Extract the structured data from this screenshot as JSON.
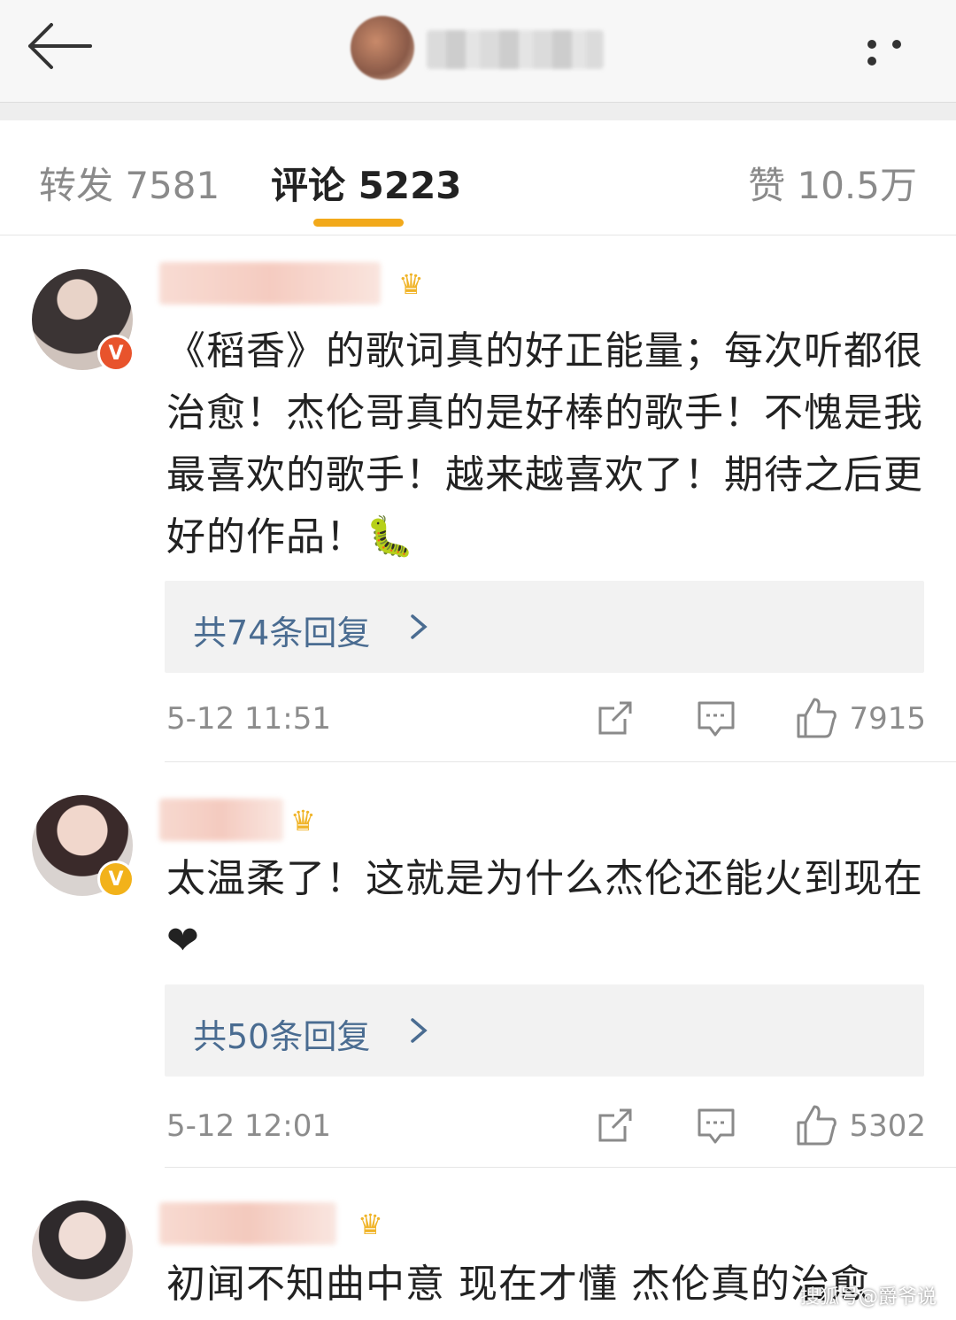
{
  "header": {
    "back_icon": "arrow-left-icon",
    "more_icon": "more-dots-icon"
  },
  "tabs": [
    {
      "label": "转发 7581"
    },
    {
      "label": "评论 5223"
    },
    {
      "label": "赞 10.5万"
    }
  ],
  "colors": {
    "accent": "#f2a91a",
    "link": "#4a6c91",
    "meta": "#8c8c8c",
    "verified_red": "#e8532c",
    "verified_gold": "#f2b21a"
  },
  "comments": [
    {
      "name_suffix": "大姐姐",
      "badge_icon": "verified-red-v-icon",
      "text": "《稻香》的歌词真的好正能量；每次听都很治愈！杰伦哥真的是好棒的歌手！不愧是我最喜欢的歌手！越来越喜欢了！期待之后更好的作品！🐛",
      "replies": "共74条回复",
      "time": "5-12 11:51",
      "likes": "7915"
    },
    {
      "name_suffix": "",
      "badge_icon": "verified-gold-v-icon",
      "text": "太温柔了！这就是为什么杰伦还能火到现在❤",
      "replies": "共50条回复",
      "time": "5-12 12:01",
      "likes": "5302"
    },
    {
      "name_suffix": "VEN",
      "badge_icon": "",
      "text": "初闻不知曲中意 现在才懂 杰伦真的治愈"
    }
  ],
  "watermark": "搜狐号@爵爷说"
}
